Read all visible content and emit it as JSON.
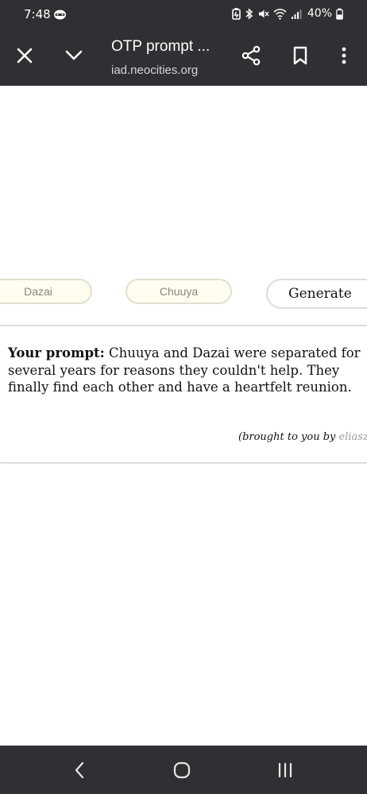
{
  "status_bar": {
    "time": "7:48",
    "battery": "40%",
    "icons": [
      "raccoon-icon",
      "battery-saver-icon",
      "bluetooth-icon",
      "mute-icon",
      "wifi-icon",
      "signal-icon",
      "battery-icon"
    ]
  },
  "toolbar": {
    "title": "OTP prompt ...",
    "url": "iad.neocities.org"
  },
  "generator": {
    "character1_value": "Dazai",
    "character2_value": "Chuuya",
    "generate_label": "Generate"
  },
  "prompt": {
    "label": "Your prompt:",
    "text": " Chuuya and Dazai were separated for several years for reasons they couldn't help. They finally find each other and have a heartfelt reunion.",
    "credit_prefix": "(brought to you by ",
    "credit_link": "eliasz"
  },
  "colors": {
    "chrome": "#2f3033",
    "pill_bg": "#fffdf0",
    "pill_border": "#e2dfcf",
    "card_border": "#dcdcdc"
  }
}
